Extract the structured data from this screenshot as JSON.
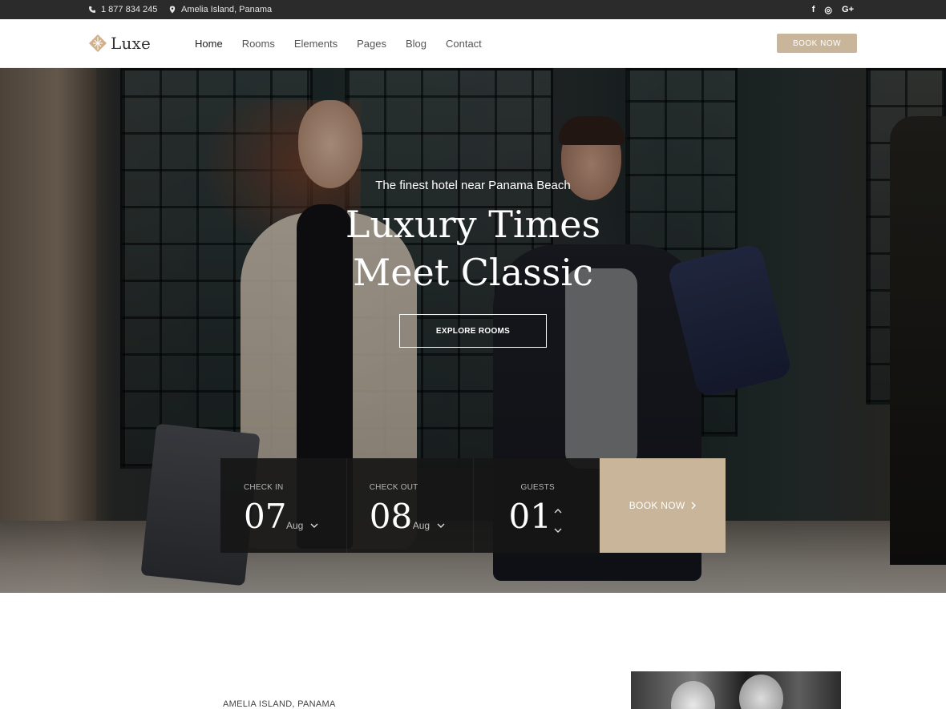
{
  "topbar": {
    "phone": "1 877 834 245",
    "location": "Amelia Island, Panama",
    "socials": [
      {
        "icon": "facebook-icon",
        "glyph": "f"
      },
      {
        "icon": "dribbble-icon",
        "glyph": "◎"
      },
      {
        "icon": "google-plus-icon",
        "glyph": "G+"
      }
    ]
  },
  "header": {
    "logo_text": "Luxe",
    "nav": [
      "Home",
      "Rooms",
      "Elements",
      "Pages",
      "Blog",
      "Contact"
    ],
    "active_nav": "Home",
    "book_now": "BOOK NOW"
  },
  "hero": {
    "subtitle": "The finest hotel near Panama Beach",
    "title_line1": "Luxury Times",
    "title_line2": "Meet Classic",
    "explore_button": "EXPLORE ROOMS"
  },
  "booking": {
    "check_in": {
      "label": "CHECK IN",
      "day": "07",
      "month": "Aug"
    },
    "check_out": {
      "label": "CHECK OUT",
      "day": "08",
      "month": "Aug"
    },
    "guests": {
      "label": "GUESTS",
      "count": "01"
    },
    "book_now": "BOOK NOW"
  },
  "intro": {
    "location_label": "AMELIA ISLAND, PANAMA"
  },
  "colors": {
    "accent": "#c8b59a",
    "topbar_bg": "#2b2b2b",
    "booking_bg": "#161616"
  }
}
